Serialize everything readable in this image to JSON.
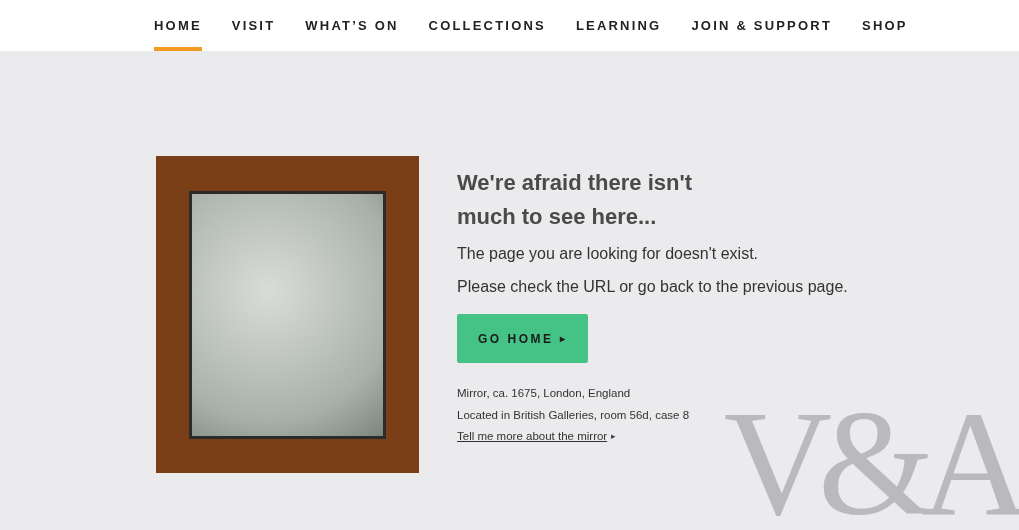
{
  "nav": [
    {
      "label": "HOME",
      "selected": true
    },
    {
      "label": "VISIT",
      "selected": false
    },
    {
      "label": "WHAT’S ON",
      "selected": false
    },
    {
      "label": "COLLECTIONS",
      "selected": false
    },
    {
      "label": "LEARNING",
      "selected": false
    },
    {
      "label": "JOIN & SUPPORT",
      "selected": false
    },
    {
      "label": "SHOP",
      "selected": false
    }
  ],
  "heading": "We're afraid there isn't much to see here...",
  "paragraphs": [
    "The page you are looking for doesn't exist.",
    "Please check the URL or go back to the previous page."
  ],
  "button": {
    "label": "GO HOME",
    "arrow": "▸"
  },
  "caption": {
    "title": "Mirror, ca. 1675, London, England",
    "location": "Located in British Galleries, room 56d, case 8",
    "link": "Tell me more about the mirror",
    "arrow": "▸"
  },
  "logo": "V&A"
}
